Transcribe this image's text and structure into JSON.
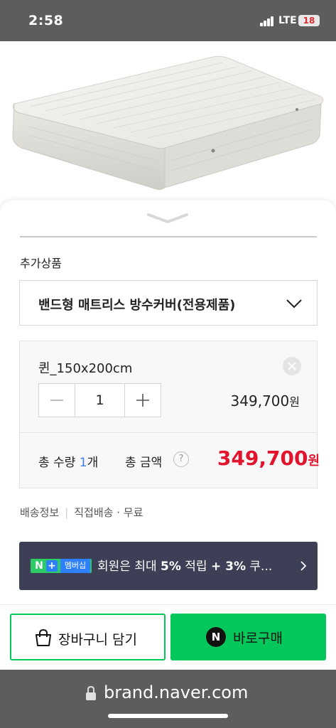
{
  "status_bar": {
    "time": "2:58",
    "network": "LTE",
    "battery": "18",
    "battery_color": "#d62c33"
  },
  "product": {
    "image_icon": "mattress-image"
  },
  "sheet": {
    "section_label": "추가상품",
    "addon_select": {
      "selected": "밴드형 매트리스 방수커버(전용제품)"
    },
    "option": {
      "name": "퀸_150x200cm",
      "quantity": "1",
      "price": "349,700",
      "price_unit": "원"
    },
    "total": {
      "qty_label": "총 수량",
      "qty": "1",
      "qty_unit": "개",
      "amount_label": "총 금액",
      "help": "?",
      "price": "349,700",
      "price_unit": "원",
      "price_color": "#e2142d"
    },
    "shipping": {
      "label": "배송정보",
      "separator": "|",
      "value": "직접배송 · 무료"
    },
    "promo": {
      "badge_n": "N",
      "badge_plus": "+",
      "badge_text": "멤버십",
      "text_prefix": "회원은 최대 ",
      "text_bold1": "5%",
      "text_mid": " 적립 ",
      "text_bold2": "+ 3%",
      "text_suffix": " 쿠...",
      "background": "#3c3f56"
    }
  },
  "actions": {
    "cart_label": "장바구니 담기",
    "buy_badge": "N",
    "buy_label": "바로구매",
    "brand_color": "#03c75a"
  },
  "browser": {
    "url": "brand.naver.com"
  }
}
